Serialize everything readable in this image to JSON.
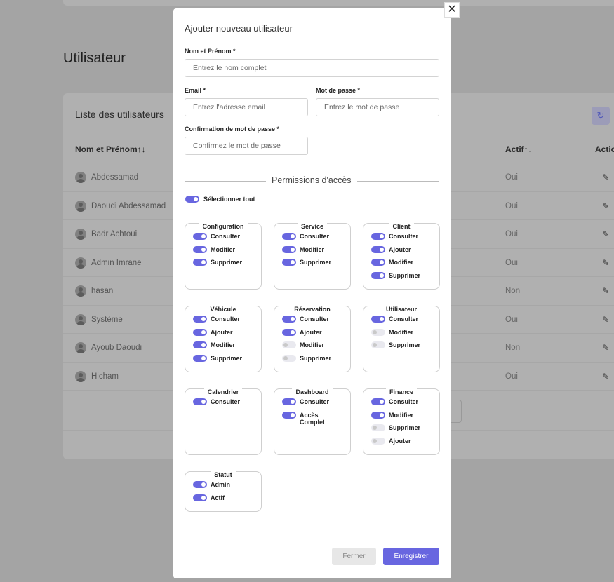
{
  "background": {
    "page_title": "Utilisateur",
    "card_title": "Liste des utilisateurs",
    "refresh_icon": "↻",
    "columns": {
      "name": "Nom et Prénom↑↓",
      "active": "Actif↑↓",
      "actions": "Actio"
    },
    "edit_icon": "✎",
    "users": [
      {
        "name": "Abdessamad",
        "active": "Oui"
      },
      {
        "name": "Daoudi Abdessamad",
        "active": "Oui"
      },
      {
        "name": "Badr Achtoui",
        "active": "Oui"
      },
      {
        "name": "Admin Imrane",
        "active": "Oui"
      },
      {
        "name": "hasan",
        "active": "Non"
      },
      {
        "name": "Système",
        "active": "Oui"
      },
      {
        "name": "Ayoub Daoudi",
        "active": "Non"
      },
      {
        "name": "Hicham",
        "active": "Oui"
      }
    ]
  },
  "modal": {
    "close_icon": "✕",
    "title": "Ajouter nouveau utilisateur",
    "fields": {
      "fullname": {
        "label": "Nom et Prénom *",
        "placeholder": "Entrez le nom complet",
        "value": ""
      },
      "email": {
        "label": "Email *",
        "placeholder": "Entrez l'adresse email",
        "value": ""
      },
      "password": {
        "label": "Mot de passe *",
        "placeholder": "Entrez le mot de passe",
        "value": ""
      },
      "confirm": {
        "label": "Confirmation de mot de passe *",
        "placeholder": "Confirmez le mot de passe",
        "value": ""
      }
    },
    "permissions_title": "Permissions d'accès",
    "select_all": {
      "label": "Sélectionner tout",
      "on": true
    },
    "groups": [
      {
        "title": "Configuration",
        "items": [
          {
            "label": "Consulter",
            "on": true
          },
          {
            "label": "Modifier",
            "on": true
          },
          {
            "label": "Supprimer",
            "on": true
          }
        ]
      },
      {
        "title": "Service",
        "items": [
          {
            "label": "Consulter",
            "on": true
          },
          {
            "label": "Modifier",
            "on": true
          },
          {
            "label": "Supprimer",
            "on": true
          }
        ]
      },
      {
        "title": "Client",
        "items": [
          {
            "label": "Consulter",
            "on": true
          },
          {
            "label": "Ajouter",
            "on": true
          },
          {
            "label": "Modifier",
            "on": true
          },
          {
            "label": "Supprimer",
            "on": true
          }
        ]
      },
      {
        "title": "Véhicule",
        "items": [
          {
            "label": "Consulter",
            "on": true
          },
          {
            "label": "Ajouter",
            "on": true
          },
          {
            "label": "Modifier",
            "on": true
          },
          {
            "label": "Supprimer",
            "on": true
          }
        ]
      },
      {
        "title": "Réservation",
        "items": [
          {
            "label": "Consulter",
            "on": true
          },
          {
            "label": "Ajouter",
            "on": true
          },
          {
            "label": "Modifier",
            "on": false
          },
          {
            "label": "Supprimer",
            "on": false
          }
        ]
      },
      {
        "title": "Utilisateur",
        "items": [
          {
            "label": "Consulter",
            "on": true
          },
          {
            "label": "Modifier",
            "on": false
          },
          {
            "label": "Supprimer",
            "on": false
          }
        ]
      },
      {
        "title": "Calendrier",
        "items": [
          {
            "label": "Consulter",
            "on": true
          }
        ]
      },
      {
        "title": "Dashboard",
        "items": [
          {
            "label": "Consulter",
            "on": true
          },
          {
            "label": "Accès Complet",
            "on": true
          }
        ]
      },
      {
        "title": "Finance",
        "items": [
          {
            "label": "Consulter",
            "on": true
          },
          {
            "label": "Modifier",
            "on": true
          },
          {
            "label": "Supprimer",
            "on": false
          },
          {
            "label": "Ajouter",
            "on": false
          }
        ]
      },
      {
        "title": "Statut",
        "items": [
          {
            "label": "Admin",
            "on": true
          },
          {
            "label": "Actif",
            "on": true
          }
        ]
      }
    ],
    "buttons": {
      "close": "Fermer",
      "save": "Enregistrer"
    }
  }
}
